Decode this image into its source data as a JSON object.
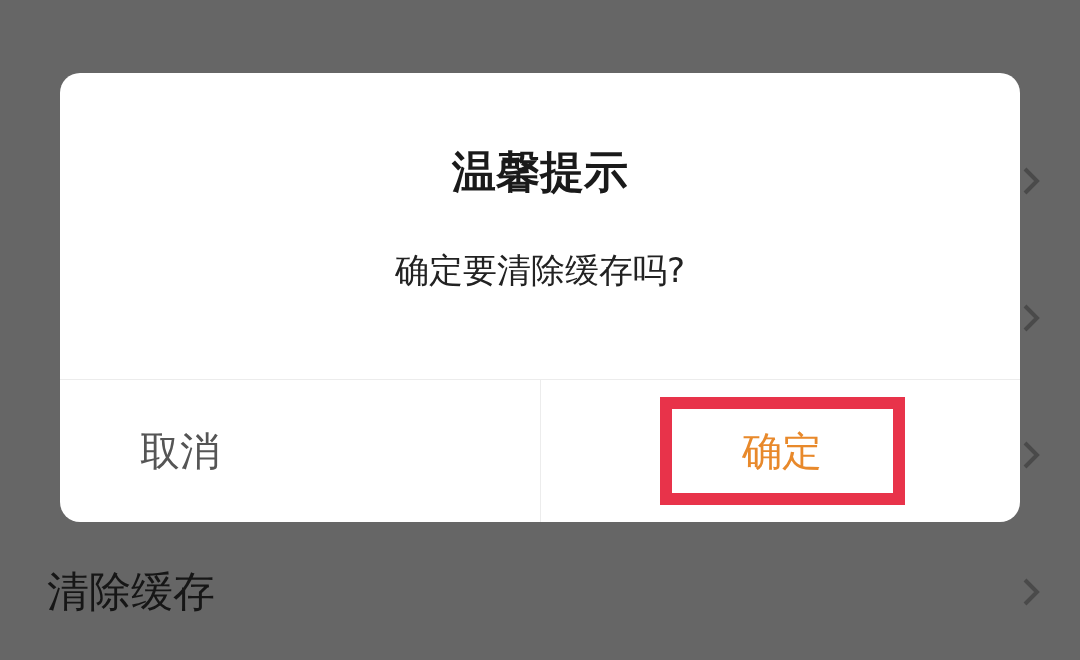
{
  "settings_rows": [
    {
      "kind": "covered"
    },
    {
      "kind": "covered"
    },
    {
      "kind": "covered"
    },
    {
      "kind": "labeled",
      "label": "清除缓存"
    }
  ],
  "dialog": {
    "title": "温馨提示",
    "message": "确定要清除缓存吗?",
    "buttons": [
      {
        "label": "取消",
        "kind": "cancel",
        "highlighted": false
      },
      {
        "label": "确定",
        "kind": "confirm",
        "highlighted": true
      }
    ]
  }
}
